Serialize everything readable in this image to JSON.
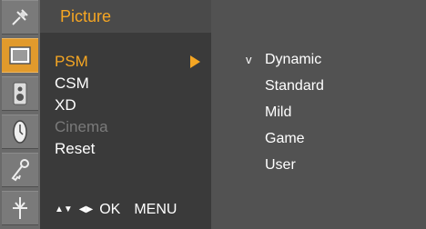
{
  "sidebar": {
    "icons": [
      {
        "name": "satellite-icon"
      },
      {
        "name": "picture-icon"
      },
      {
        "name": "audio-speaker-icon"
      },
      {
        "name": "clock-icon"
      },
      {
        "name": "option-key-icon"
      },
      {
        "name": "input-plug-icon"
      }
    ],
    "active_index": 1
  },
  "menu": {
    "title": "Picture",
    "items": [
      {
        "label": "PSM",
        "state": "selected"
      },
      {
        "label": "CSM",
        "state": "normal"
      },
      {
        "label": "XD",
        "state": "normal"
      },
      {
        "label": "Cinema",
        "state": "disabled"
      },
      {
        "label": "Reset",
        "state": "normal"
      }
    ],
    "nav_hint": {
      "arrows_updown": "▲▼",
      "arrows_leftright": "◀▶",
      "ok": "OK",
      "menu": "MENU"
    }
  },
  "submenu": {
    "check_mark": "v",
    "items": [
      {
        "label": "Dynamic",
        "checked": true
      },
      {
        "label": "Standard",
        "checked": false
      },
      {
        "label": "Mild",
        "checked": false
      },
      {
        "label": "Game",
        "checked": false
      },
      {
        "label": "User",
        "checked": false
      }
    ]
  },
  "colors": {
    "accent": "#f5a623",
    "active_icon_bg": "#e19a2c",
    "text": "#ffffff",
    "disabled": "#7a7a7a"
  }
}
